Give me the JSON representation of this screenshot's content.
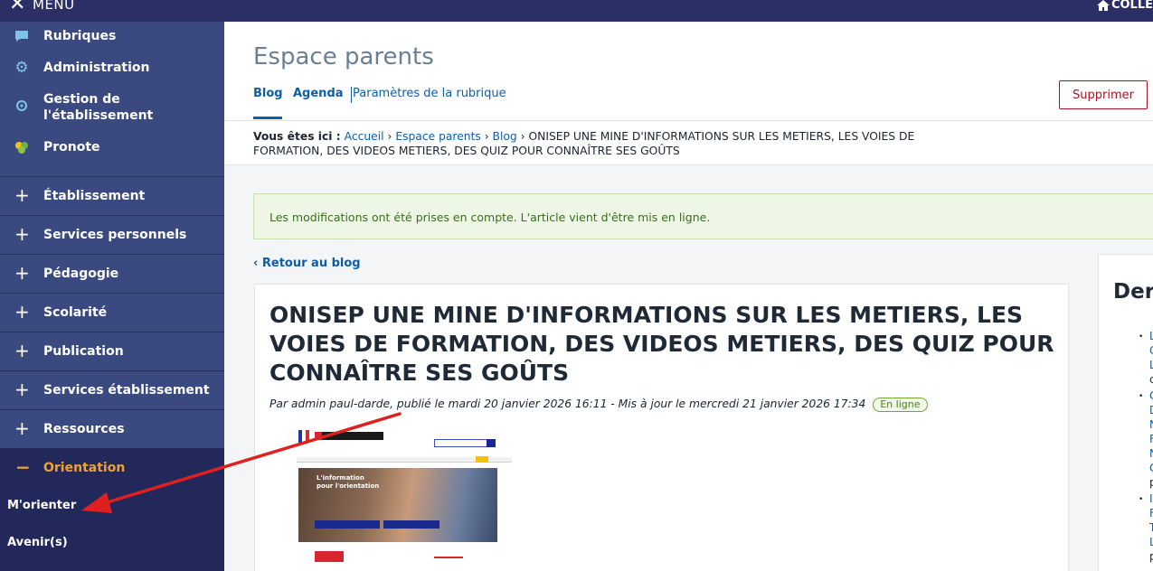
{
  "sidebar": {
    "menu_label": "MENU",
    "top_items": [
      {
        "label": "Rubriques",
        "icon": "chat-icon"
      },
      {
        "label": "Administration",
        "icon": "gear-icon"
      },
      {
        "label": "Gestion de l'établissement",
        "icon": "location-icon"
      },
      {
        "label": "Pronote",
        "icon": "pronote-icon"
      }
    ],
    "sections": [
      "Établissement",
      "Services personnels",
      "Pédagogie",
      "Scolarité",
      "Publication",
      "Services établissement",
      "Ressources"
    ],
    "open_section": "Orientation",
    "open_items": [
      "M'orienter",
      "Avenir(s)"
    ]
  },
  "topbar": {
    "college_label": "COLLE"
  },
  "header": {
    "title": "Espace parents",
    "tabs": [
      "Blog",
      "Agenda",
      "Paramètres de la rubrique"
    ],
    "delete_label": "Supprimer"
  },
  "breadcrumb": {
    "prefix": "Vous êtes ici :",
    "links": [
      "Accueil",
      "Espace parents",
      "Blog"
    ],
    "current": "ONISEP UNE MINE D'INFORMATIONS SUR LES METIERS, LES VOIES DE FORMATION, DES VIDEOS METIERS, DES QUIZ POUR CONNAÎTRE SES GOÛTS"
  },
  "alert": {
    "message": "Les modifications ont été prises en compte. L'article vient d'être mis en ligne."
  },
  "back_link": "‹ Retour au blog",
  "article": {
    "title": "ONISEP UNE MINE D'INFORMATIONS SUR LES METIERS, LES VOIES DE FORMATION, DES VIDEOS METIERS, DES QUIZ POUR CONNAÎTRE SES GOÛTS",
    "meta": "Par admin paul-darde, publié le mardi 20 janvier 2026 16:11 - Mis à jour le mercredi 21 janvier 2026 17:34",
    "status": "En ligne",
    "thumb": {
      "heading_line1": "L'information",
      "heading_line2": "pour l'orientation"
    }
  },
  "right_panel": {
    "title": "Dern",
    "fragments": [
      "L",
      "C",
      "L",
      "c",
      "C",
      "D",
      "N",
      "F",
      "N",
      "C",
      "p",
      "I",
      "F",
      "T",
      "L",
      "p"
    ]
  },
  "colors": {
    "sidebar": "#3a4a80",
    "sidebar_dark": "#23285a",
    "topbar": "#2b2f66",
    "accent_orange": "#f0a22e",
    "link_blue": "#0d5ea8",
    "danger_red": "#a6121e",
    "annotation_red": "#e02020"
  }
}
